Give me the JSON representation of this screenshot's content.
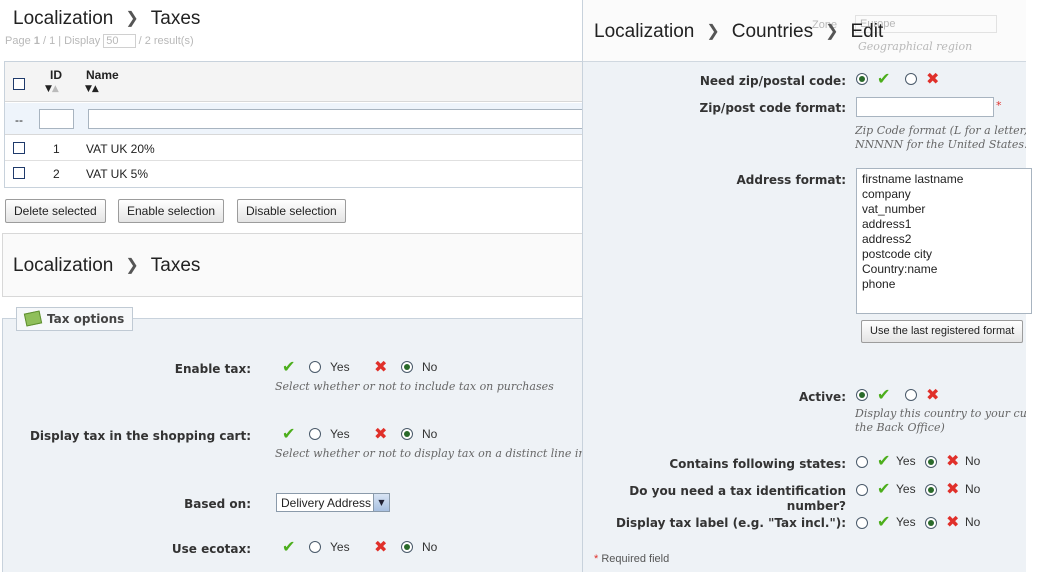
{
  "taxes_list": {
    "breadcrumb": [
      "Localization",
      "Taxes"
    ],
    "pagination": {
      "page": "Page",
      "current": "1",
      "of": "/ 1 | Display",
      "per_page": "50",
      "results": "/ 2 result(s)"
    },
    "columns": {
      "id": "ID",
      "name": "Name"
    },
    "filter_placeholder": "--",
    "rows": [
      {
        "id": "1",
        "name": "VAT UK 20%"
      },
      {
        "id": "2",
        "name": "VAT UK 5%"
      }
    ],
    "buttons": {
      "delete": "Delete selected",
      "enable": "Enable selection",
      "disable": "Disable selection"
    }
  },
  "tax_options": {
    "breadcrumb": [
      "Localization",
      "Taxes"
    ],
    "legend": "Tax options",
    "yes": "Yes",
    "no": "No",
    "enable_tax": {
      "label": "Enable tax:",
      "help": "Select whether or not to include tax on purchases"
    },
    "display_tax": {
      "label": "Display tax in the shopping cart:",
      "help": "Select whether or not to display tax on a distinct line in the cart"
    },
    "based_on": {
      "label": "Based on:",
      "value": "Delivery Address"
    },
    "ecotax": {
      "label": "Use ecotax:"
    }
  },
  "country_edit": {
    "breadcrumb": [
      "Localization",
      "Countries",
      "Edit"
    ],
    "ghost_zone_label": "Zone",
    "ghost_zone_value": "Europe",
    "ghost_zone_help": "Geographical region",
    "yes": "Yes",
    "no": "No",
    "need_zip": {
      "label": "Need zip/postal code:"
    },
    "zip_format": {
      "label": "Zip/post code format:",
      "value": "",
      "help1": "Zip Code format (L for a letter, N",
      "help2": "NNNNN for the United States. If"
    },
    "address_format": {
      "label": "Address format:",
      "lines": [
        "firstname lastname",
        "company",
        "vat_number",
        "address1",
        "address2",
        "postcode city",
        "Country:name",
        "phone"
      ],
      "button": "Use the last registered format"
    },
    "active": {
      "label": "Active:",
      "help1": "Display this country to your cu",
      "help2": "the Back Office)"
    },
    "contains_states": {
      "label": "Contains following states:"
    },
    "tax_id": {
      "label1": "Do you need a tax identification",
      "label2": "number?"
    },
    "tax_label": {
      "label": "Display tax label (e.g. \"Tax incl.\"):"
    },
    "required_note": "Required field",
    "required_star": "*"
  },
  "colors": {
    "check": "#4cae1c",
    "cross": "#e0302a",
    "panel": "#eef2f6",
    "border": "#c8d2dc"
  },
  "icons": [
    "check-icon",
    "cross-icon",
    "tax-icon",
    "sort-arrows-icon",
    "chevron-right-icon",
    "dropdown-arrow-icon"
  ]
}
